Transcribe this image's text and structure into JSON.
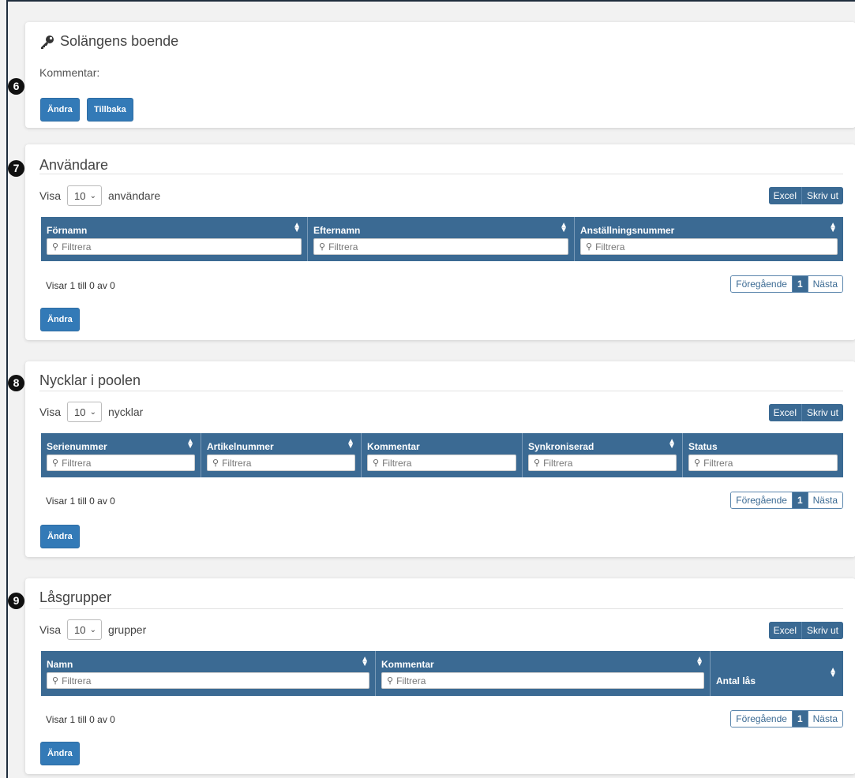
{
  "badges": [
    "6",
    "7",
    "8",
    "9"
  ],
  "location": {
    "title": "Solängens boende",
    "comment_label": "Kommentar:",
    "edit_label": "Ändra",
    "back_label": "Tillbaka"
  },
  "common": {
    "show_prefix": "Visa",
    "page_size": "10",
    "excel_label": "Excel",
    "print_label": "Skriv ut",
    "filter_placeholder": "Filtrera",
    "info_text": "Visar 1 till 0 av 0",
    "prev_label": "Föregående",
    "page_number": "1",
    "next_label": "Nästa",
    "edit_label": "Ändra"
  },
  "users": {
    "title": "Användare",
    "show_suffix": "användare",
    "columns": [
      "Förnamn",
      "Efternamn",
      "Anställningsnummer"
    ]
  },
  "keys": {
    "title": "Nycklar i poolen",
    "show_suffix": "nycklar",
    "columns": [
      "Serienummer",
      "Artikelnummer",
      "Kommentar",
      "Synkroniserad",
      "Status"
    ]
  },
  "lockgroups": {
    "title": "Låsgrupper",
    "show_suffix": "grupper",
    "columns": [
      "Namn",
      "Kommentar",
      "Antal lås"
    ]
  }
}
